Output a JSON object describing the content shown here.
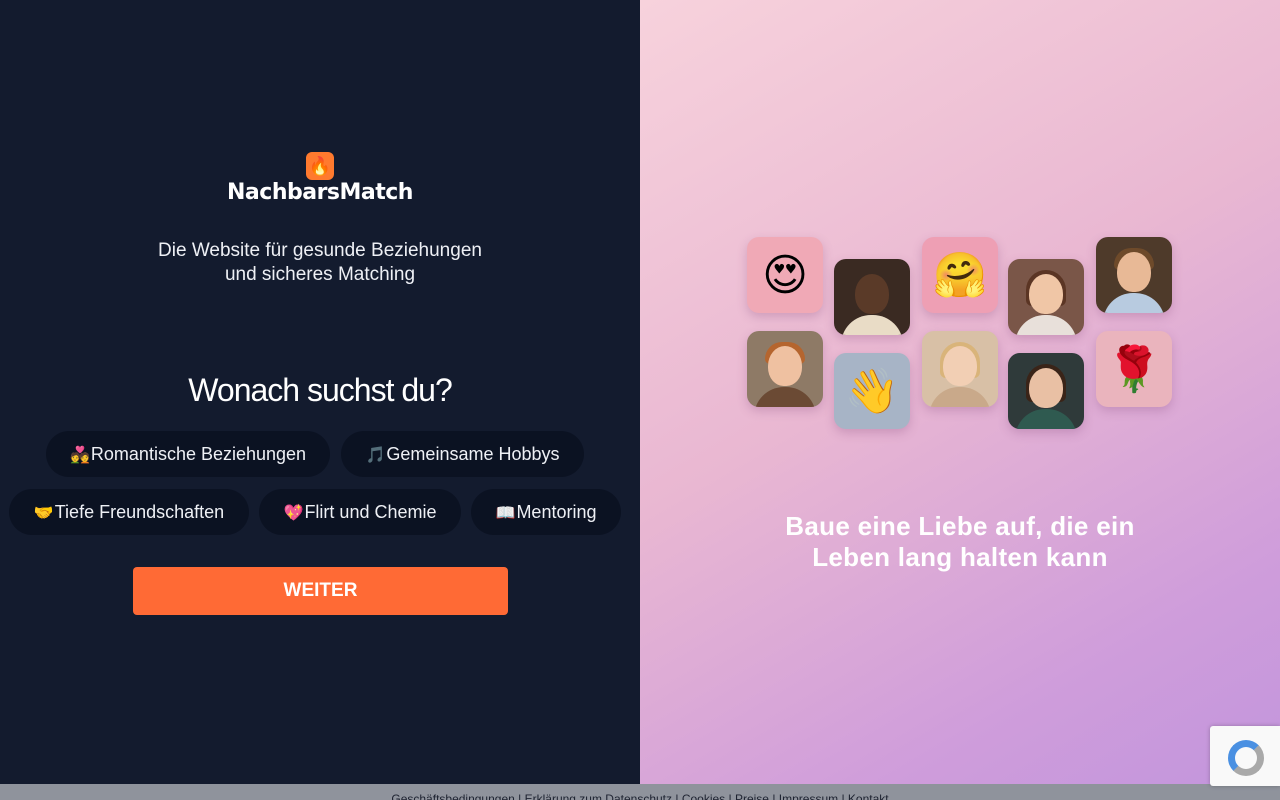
{
  "brand": {
    "name": "NachbarsMatch",
    "flame_icon": "flame-icon",
    "flame_glyph": "🔥"
  },
  "tagline": {
    "line1": "Die Website für gesunde Beziehungen",
    "line2": "und sicheres Matching"
  },
  "question": "Wonach suchst du?",
  "options": [
    {
      "icon": "💑",
      "icon_name": "couple-heart-icon",
      "label": "Romantische Beziehungen"
    },
    {
      "icon": "🎵",
      "icon_name": "music-note-icon",
      "label": "Gemeinsame Hobbys"
    },
    {
      "icon": "🤝",
      "icon_name": "handshake-icon",
      "label": "Tiefe Freundschaften"
    },
    {
      "icon": "💖",
      "icon_name": "sparkling-heart-icon",
      "label": "Flirt und Chemie"
    },
    {
      "icon": "📖",
      "icon_name": "open-book-icon",
      "label": "Mentoring"
    }
  ],
  "continue_button": "WEITER",
  "collage": {
    "heart_eyes": "😍",
    "hug": "🤗",
    "wave": "👋",
    "rose": "🌹"
  },
  "slogan": {
    "line1": "Baue eine Liebe auf, die ein",
    "line2": "Leben lang halten kann"
  },
  "footer": {
    "links": [
      "Geschäftsbedingungen",
      "Erklärung zum Datenschutz",
      "Cookies",
      "Preise",
      "Impressum",
      "Kontakt"
    ],
    "separator": " | "
  },
  "colors": {
    "left_bg": "#131b2e",
    "chip_bg": "#0b1222",
    "accent": "#ff6a35",
    "gradient_start": "#f7d2dc",
    "gradient_end": "#c295dc"
  }
}
